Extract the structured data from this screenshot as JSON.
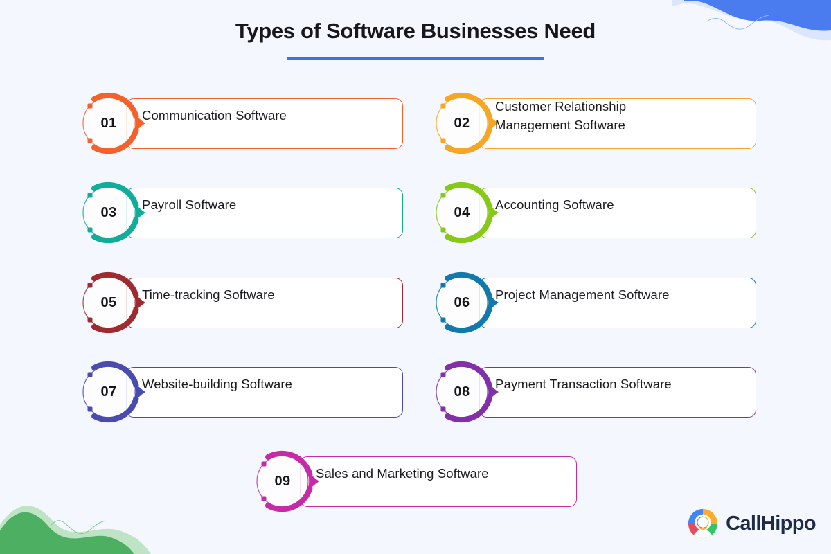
{
  "header": {
    "title": "Types of Software Businesses Need",
    "rule_color": "#3d73dd"
  },
  "background_color": "#f4f7fe",
  "decorations": {
    "top_right_blob": {
      "name": "blue-wave-blob",
      "color": "#4a7cf0"
    },
    "bottom_left_blob": {
      "name": "green-wave-blob",
      "color": "#4caf62"
    }
  },
  "items": [
    {
      "number": "01",
      "label": "Communication Software",
      "color": "#f4612b",
      "tint": "#fdeee8"
    },
    {
      "number": "02",
      "label": "Customer Relationship Management Software",
      "color": "#f5a623",
      "tint": "#fdf4e4"
    },
    {
      "number": "03",
      "label": "Payroll Software",
      "color": "#0fad9a",
      "tint": "#e4f6f3"
    },
    {
      "number": "04",
      "label": "Accounting Software",
      "color": "#86c916",
      "tint": "#f0f8e1"
    },
    {
      "number": "05",
      "label": "Time-tracking Software",
      "color": "#9f2b31",
      "tint": "#f5e7e8"
    },
    {
      "number": "06",
      "label": "Project Management Software",
      "color": "#1279ad",
      "tint": "#e3f0f7"
    },
    {
      "number": "07",
      "label": "Website-building Software",
      "color": "#4a4bae",
      "tint": "#eaeaf6"
    },
    {
      "number": "08",
      "label": "Payment Transaction Software",
      "color": "#8130a8",
      "tint": "#f2e7f7"
    },
    {
      "number": "09",
      "label": "Sales and Marketing Software",
      "color": "#c62aa6",
      "tint": "#fae6f5"
    }
  ],
  "logo": {
    "name": "CallHippo",
    "text": "CallHippo",
    "mark_colors": {
      "blue": "#4285f4",
      "red": "#ea4a5f",
      "orange": "#fbac2c",
      "green": "#34c465"
    },
    "text_color": "#1f2b46"
  }
}
